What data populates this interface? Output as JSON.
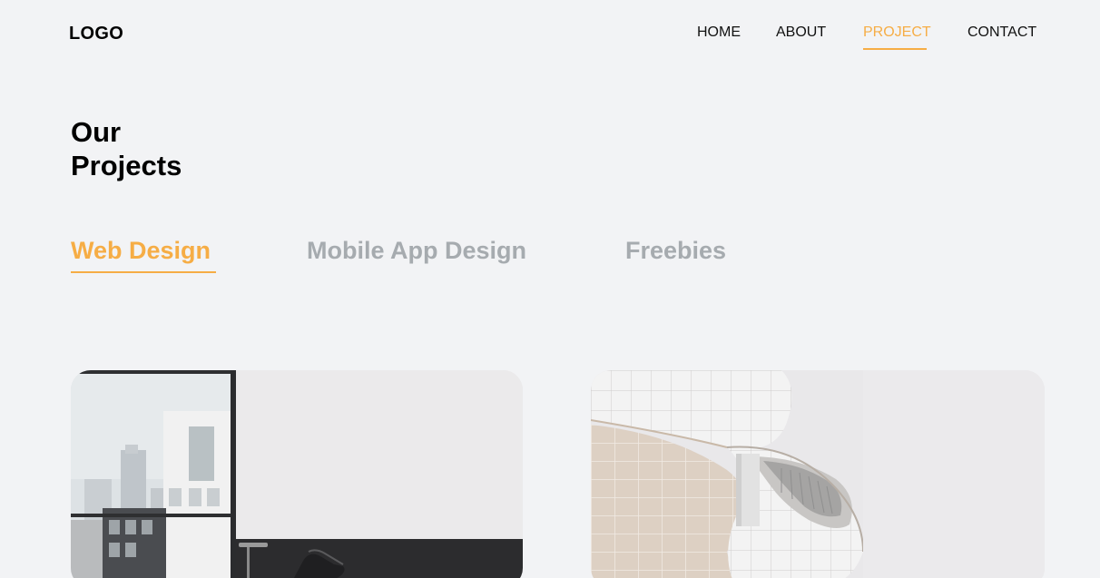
{
  "header": {
    "logo": "LOGO",
    "nav": [
      {
        "label": "HOME",
        "active": false
      },
      {
        "label": "ABOUT",
        "active": false
      },
      {
        "label": "PROJECT",
        "active": true
      },
      {
        "label": "CONTACT",
        "active": false
      }
    ]
  },
  "main": {
    "title_line1": "Our",
    "title_line2": "Projects",
    "tabs": [
      {
        "label": "Web Design",
        "active": true
      },
      {
        "label": "Mobile App Design",
        "active": false
      },
      {
        "label": "Freebies",
        "active": false
      }
    ],
    "projects": [
      {
        "image": "interior-room-photo"
      },
      {
        "image": "curved-architecture-photo"
      }
    ]
  },
  "colors": {
    "accent": "#f6ad45",
    "background": "#f2f3f5",
    "inactive_tab": "#a6abaf",
    "text": "#000000"
  }
}
